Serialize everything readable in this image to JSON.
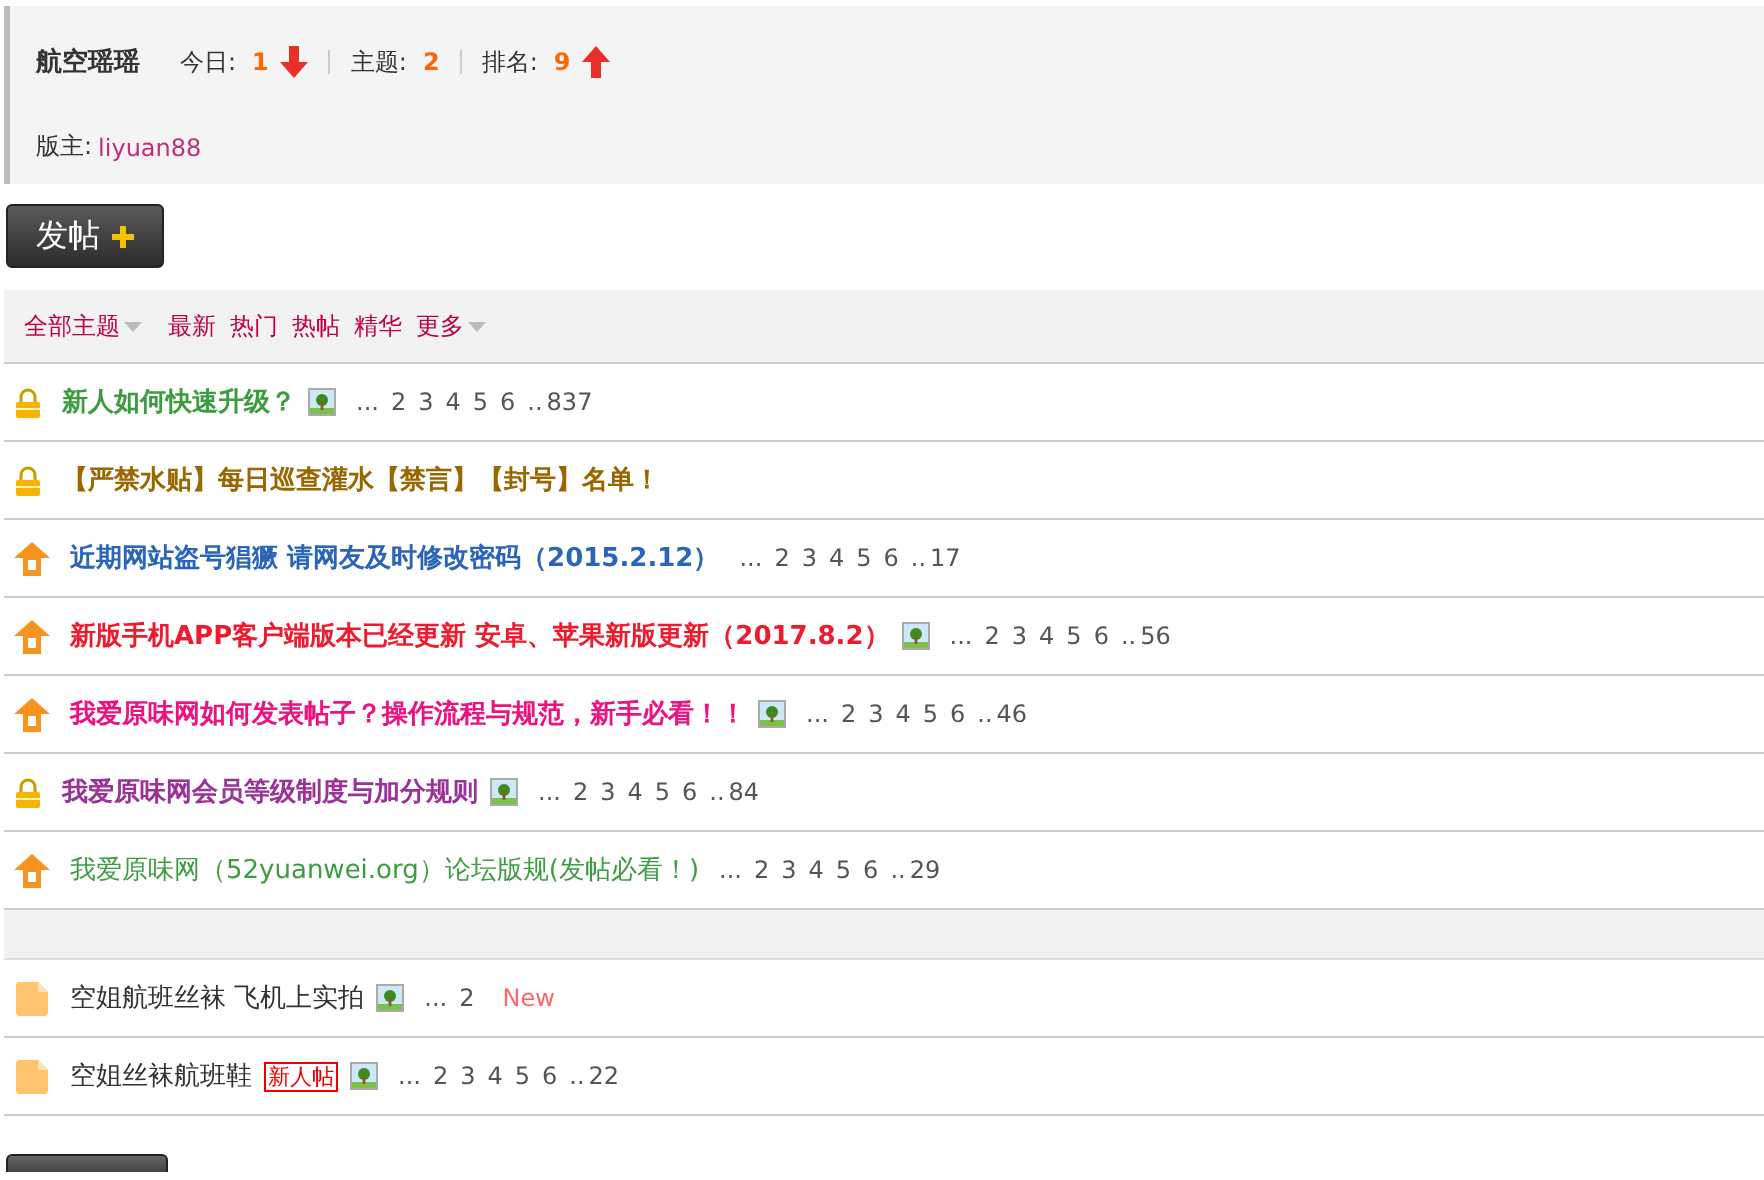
{
  "forum": {
    "name": "航空瑶瑶",
    "stats": [
      {
        "label": "今日:",
        "value": "1",
        "kind": "down"
      },
      {
        "label": "主题:",
        "value": "2",
        "kind": "flat"
      },
      {
        "label": "排名:",
        "value": "9",
        "kind": "up"
      }
    ],
    "moderator_label": "版主:",
    "moderator": "liyuan88"
  },
  "post_button": {
    "label": "发帖"
  },
  "filters": [
    {
      "label": "全部主题",
      "dropdown": true
    },
    {
      "label": "最新",
      "dropdown": false
    },
    {
      "label": "热门",
      "dropdown": false
    },
    {
      "label": "热帖",
      "dropdown": false
    },
    {
      "label": "精华",
      "dropdown": false
    },
    {
      "label": "更多",
      "dropdown": true
    }
  ],
  "sticky_threads": [
    {
      "kind": "locked",
      "title": "新人如何快速升级？",
      "color": "#3c9d40",
      "bold": true,
      "image": true,
      "pager": {
        "lead": "...",
        "pages": [
          "2",
          "3",
          "4",
          "5",
          "6"
        ],
        "gap": "..",
        "last": "837"
      }
    },
    {
      "kind": "locked",
      "title": "【严禁水贴】每日巡查灌水【禁言】【封号】名单！",
      "color": "#996600",
      "bold": true,
      "image": false
    },
    {
      "kind": "pinned",
      "title": "近期网站盗号猖獗 请网友及时修改密码（2015.2.12）",
      "color": "#2b65b7",
      "bold": true,
      "image": false,
      "pager": {
        "lead": "...",
        "pages": [
          "2",
          "3",
          "4",
          "5",
          "6"
        ],
        "gap": "..",
        "last": "17"
      }
    },
    {
      "kind": "pinned",
      "title": "新版手机APP客户端版本已经更新 安卓、苹果新版更新（2017.8.2）",
      "color": "#ee1b2e",
      "bold": true,
      "image": true,
      "pager": {
        "lead": "...",
        "pages": [
          "2",
          "3",
          "4",
          "5",
          "6"
        ],
        "gap": "..",
        "last": "56"
      }
    },
    {
      "kind": "pinned",
      "title": "我爱原味网如何发表帖子？操作流程与规范，新手必看！！",
      "color": "#ec1282",
      "bold": true,
      "image": true,
      "pager": {
        "lead": "...",
        "pages": [
          "2",
          "3",
          "4",
          "5",
          "6"
        ],
        "gap": "..",
        "last": "46"
      }
    },
    {
      "kind": "locked",
      "title": "我爱原味网会员等级制度与加分规则",
      "color": "#993399",
      "bold": true,
      "image": true,
      "pager": {
        "lead": "...",
        "pages": [
          "2",
          "3",
          "4",
          "5",
          "6"
        ],
        "gap": "..",
        "last": "84"
      }
    },
    {
      "kind": "pinned",
      "title": "我爱原味网（52yuanwei.org）论坛版规(发帖必看！)",
      "color": "#3c9d40",
      "bold": false,
      "image": false,
      "pager": {
        "lead": "...",
        "pages": [
          "2",
          "3",
          "4",
          "5",
          "6"
        ],
        "gap": "..",
        "last": "29"
      }
    }
  ],
  "threads": [
    {
      "kind": "normal",
      "title": "空姐航班丝袜 飞机上实拍",
      "color": "#333333",
      "bold": false,
      "image": true,
      "pager": {
        "lead": "...",
        "pages": [
          "2"
        ]
      },
      "new_tag": "New"
    },
    {
      "kind": "normal",
      "title": "空姐丝袜航班鞋",
      "color": "#333333",
      "bold": false,
      "badge": "新人帖",
      "image": true,
      "pager": {
        "lead": "...",
        "pages": [
          "2",
          "3",
          "4",
          "5",
          "6"
        ],
        "gap": "..",
        "last": "22"
      }
    }
  ]
}
